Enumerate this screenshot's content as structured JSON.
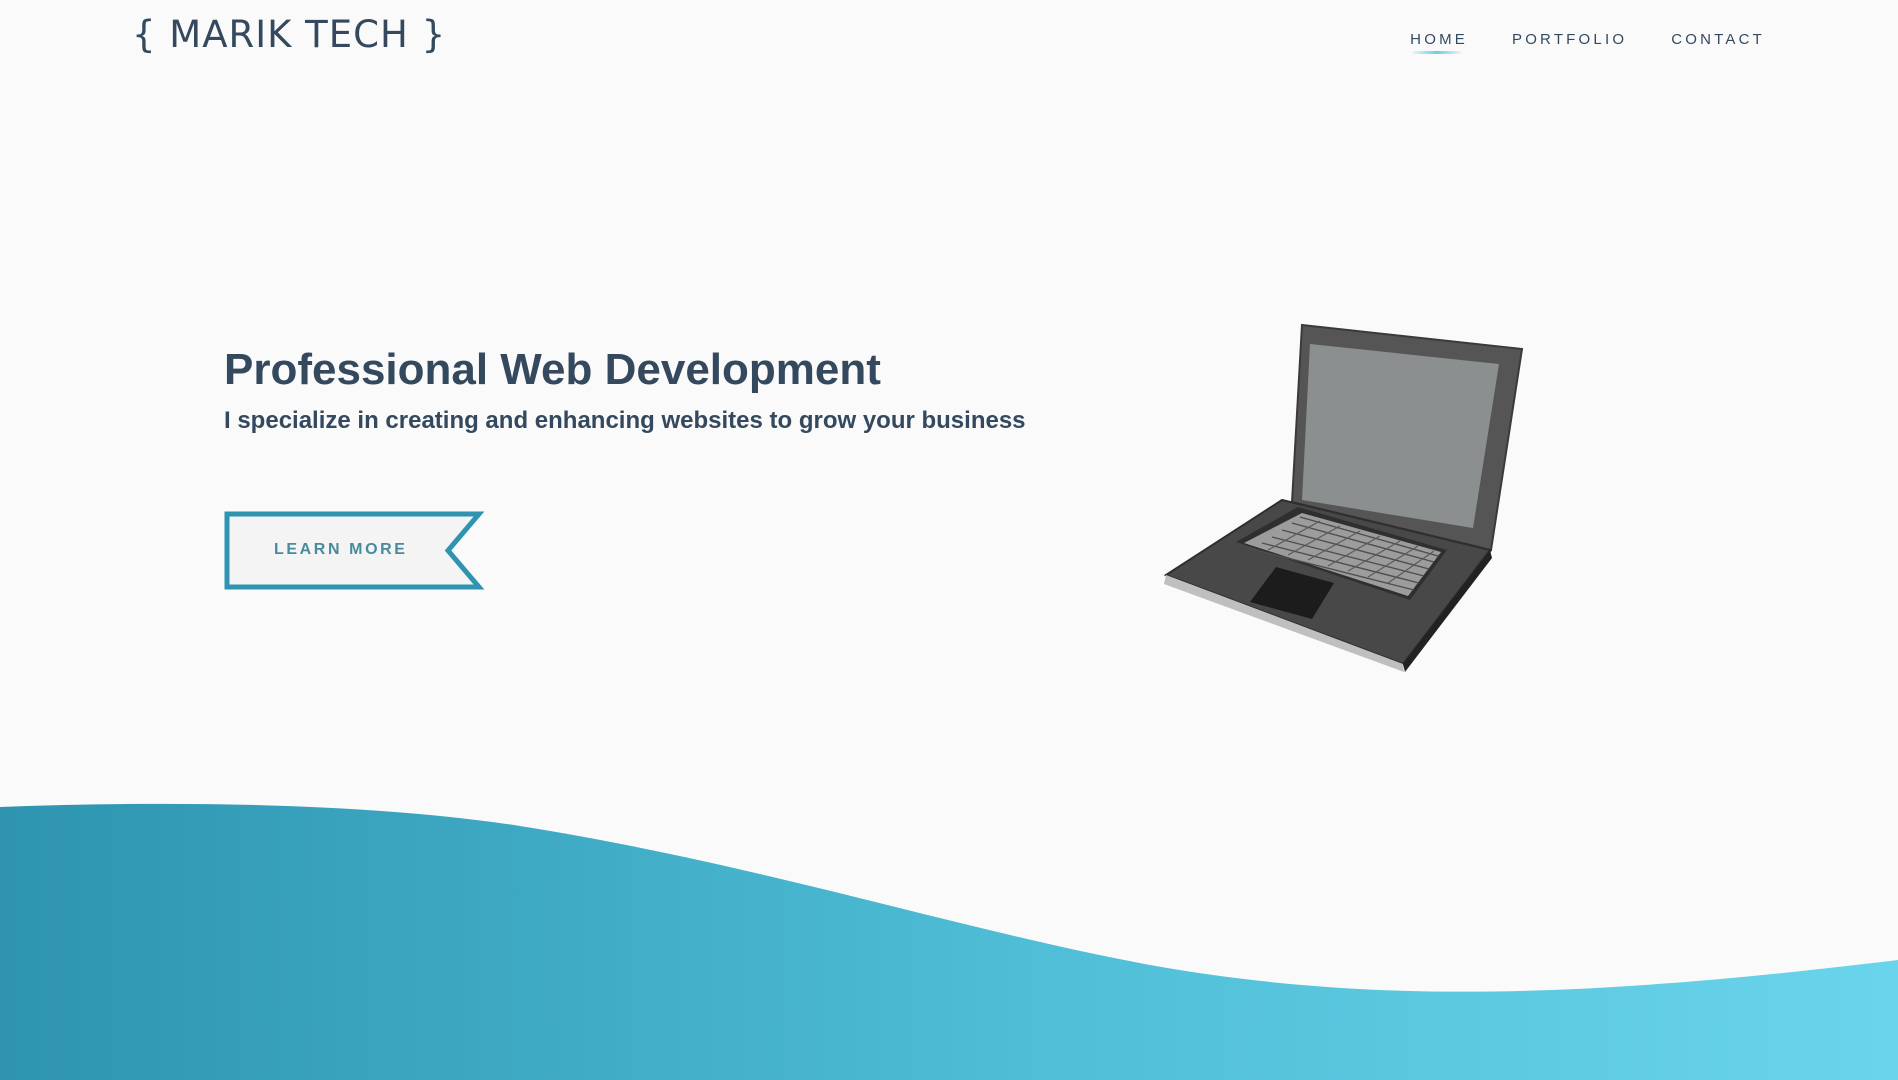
{
  "header": {
    "logo": "{ MARIK TECH }",
    "nav": [
      {
        "label": "HOME",
        "active": true
      },
      {
        "label": "PORTFOLIO",
        "active": false
      },
      {
        "label": "CONTACT",
        "active": false
      }
    ]
  },
  "hero": {
    "title": "Professional Web Development",
    "subtitle": "I specialize in creating and enhancing websites to grow your business",
    "cta_label": "LEARN MORE",
    "illustration": "laptop-illustration"
  },
  "colors": {
    "text": "#34495e",
    "accent": "#2e94b0",
    "accent_light": "#6ad4ec",
    "background": "#fafafa"
  }
}
